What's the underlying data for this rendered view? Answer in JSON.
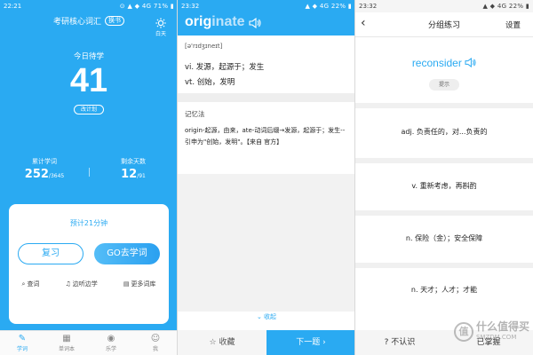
{
  "screen1": {
    "status": {
      "time": "22:21",
      "right": "⊙ ▲ ◆ 4G 71% ▮"
    },
    "header": {
      "title": "考研核心词汇",
      "switch_label": "换书"
    },
    "sun_label": "白天",
    "today_label": "今日待学",
    "today_count": "41",
    "plan_label": "改计划",
    "stats": {
      "learned_label": "累计学词",
      "learned_value": "252",
      "learned_total": "/3645",
      "days_label": "剩余天数",
      "days_value": "12",
      "days_total": "/91"
    },
    "card": {
      "estimate": "预计21分钟",
      "review_label": "复习",
      "learn_label": "GO去学词",
      "links": [
        "查词",
        "边听边学",
        "更多词库"
      ]
    },
    "tabs": [
      "学词",
      "单词本",
      "乐学",
      "我"
    ]
  },
  "screen2": {
    "status": {
      "time": "23:32",
      "right": "▲ ◆ 4G 22% ▮"
    },
    "word_part1": "orig",
    "word_part2": "inate",
    "phonetic": "[ə'rɪdʒɪneɪt]",
    "def1": "vi. 发源，起源于；发生",
    "def2": "vt. 创始，发明",
    "mem_title": "记忆法",
    "mem_text": "origin-起源，由来，ate-动词后缀→发源，起源于；发生--引申为\"创始，发明\"。【来自 官方】",
    "collapse_label": "收起",
    "fav_label": "收藏",
    "next_label": "下一题 ›"
  },
  "screen3": {
    "status": {
      "time": "23:32",
      "right": "▲ ◆ 4G 22% ▮"
    },
    "title": "分组练习",
    "settings_label": "设置",
    "word": "reconsider",
    "hint_label": "提示",
    "options": [
      "adj. 负责任的，对...负责的",
      "v. 重新考虑，再斟酌",
      "n. 保险（金）；安全保障",
      "n. 天才；人才；才能"
    ],
    "unknown_label": "? 不认识",
    "mastered_label": "已掌握"
  },
  "watermark": {
    "circle": "值",
    "line1": "什么值得买",
    "line2": "SMZDM.COM"
  },
  "colors": {
    "accent": "#2aaaf2"
  }
}
